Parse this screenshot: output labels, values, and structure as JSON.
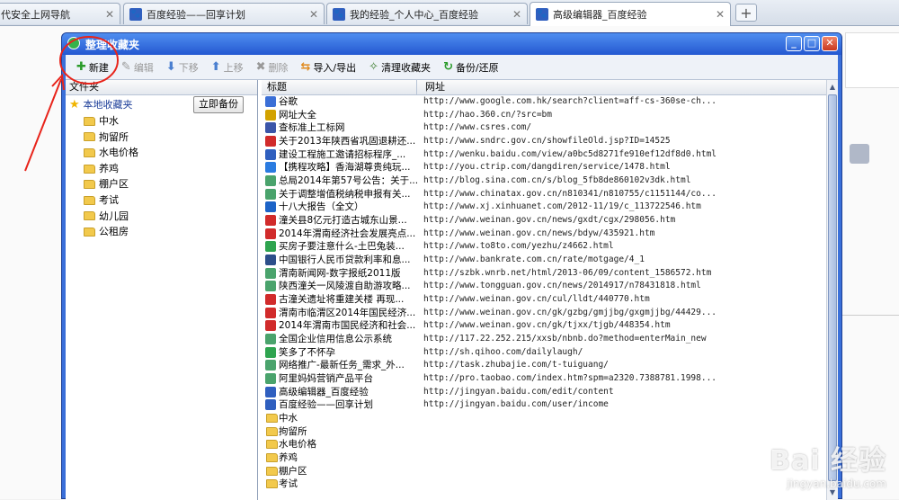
{
  "browser": {
    "tabs": [
      {
        "label": "代安全上网导航",
        "favicon": "360-icon",
        "active": false
      },
      {
        "label": "百度经验——回享计划",
        "favicon": "baidu-paw-icon",
        "active": false
      },
      {
        "label": "我的经验_个人中心_百度经验",
        "favicon": "baidu-paw-icon",
        "active": false
      },
      {
        "label": "高级编辑器_百度经验",
        "favicon": "baidu-paw-icon",
        "active": true
      }
    ],
    "new_tab_glyph": "+"
  },
  "dialog": {
    "title": "整理收藏夹",
    "toolbar": [
      {
        "label": "新建",
        "icon": "plus-icon",
        "color": "#2a9b2a",
        "enabled": true
      },
      {
        "label": "编辑",
        "icon": "pencil-icon",
        "color": "#999999",
        "enabled": false
      },
      {
        "label": "下移",
        "icon": "arrow-down-icon",
        "color": "#4a7fd0",
        "enabled": false
      },
      {
        "label": "上移",
        "icon": "arrow-up-icon",
        "color": "#4a7fd0",
        "enabled": false
      },
      {
        "label": "删除",
        "icon": "delete-x-icon",
        "color": "#999999",
        "enabled": false
      },
      {
        "label": "导入/导出",
        "icon": "import-export-icon",
        "color": "#e08a1e",
        "enabled": true
      },
      {
        "label": "清理收藏夹",
        "icon": "broom-icon",
        "color": "#3b7d2e",
        "enabled": true
      },
      {
        "label": "备份/还原",
        "icon": "refresh-icon",
        "color": "#2a9b2a",
        "enabled": true
      }
    ],
    "left": {
      "header": "文件夹",
      "root": "本地收藏夹",
      "backup_button": "立即备份",
      "folders": [
        "中水",
        "拘留所",
        "水电价格",
        "养鸡",
        "棚户区",
        "考试",
        "幼儿园",
        "公租房"
      ]
    },
    "right": {
      "col_title": "标题",
      "col_url": "网址",
      "rows": [
        {
          "title": "谷歌",
          "url": "http://www.google.com.hk/search?client=aff-cs-360se-ch...",
          "icon": "google-icon",
          "color": "#3b6fd6"
        },
        {
          "title": "网址大全",
          "url": "http://hao.360.cn/?src=bm",
          "icon": "360-icon",
          "color": "#d2a200"
        },
        {
          "title": "查标准上工标网",
          "url": "http://www.csres.com/",
          "icon": "shield-icon",
          "color": "#3b55a8"
        },
        {
          "title": "关于2013年陕西省巩固退耕还...",
          "url": "http://www.sndrc.gov.cn/showfileOld.jsp?ID=14525",
          "icon": "emblem-icon",
          "color": "#d12b2b"
        },
        {
          "title": "建设工程施工邀请招标程序_...",
          "url": "http://wenku.baidu.com/view/a0bc5d8271fe910ef12df8d0.html",
          "icon": "baidu-paw-icon",
          "color": "#2f5fbf"
        },
        {
          "title": "【携程攻略】香海湖尊贵纯玩...",
          "url": "http://you.ctrip.com/dangdiren/service/1478.html",
          "icon": "ctrip-icon",
          "color": "#2a7be0"
        },
        {
          "title": "总局2014年第57号公告：关于...",
          "url": "http://blog.sina.com.cn/s/blog_5fb8de860102v3dk.html",
          "icon": "page-icon",
          "color": "#4aa36c"
        },
        {
          "title": "关于调整增值税纳税申报有关...",
          "url": "http://www.chinatax.gov.cn/n810341/n810755/c1151144/co...",
          "icon": "page-icon",
          "color": "#4aa36c"
        },
        {
          "title": "十八大报告（全文）",
          "url": "http://www.xj.xinhuanet.com/2012-11/19/c_113722546.htm",
          "icon": "xinhua-icon",
          "color": "#1c63c7"
        },
        {
          "title": "潼关县8亿元打造古城东山景...",
          "url": "http://www.weinan.gov.cn/news/gxdt/cgx/298056.htm",
          "icon": "emblem-icon",
          "color": "#d12b2b"
        },
        {
          "title": "2014年渭南经济社会发展亮点...",
          "url": "http://www.weinan.gov.cn/news/bdyw/435921.htm",
          "icon": "emblem-icon",
          "color": "#d12b2b"
        },
        {
          "title": "买房子要注意什么-土巴兔装...",
          "url": "http://www.to8to.com/yezhu/z4662.html",
          "icon": "to8to-icon",
          "color": "#2ea44f"
        },
        {
          "title": "中国银行人民币贷款利率和息...",
          "url": "http://www.bankrate.com.cn/rate/motgage/4_1",
          "icon": "bankrate-icon",
          "color": "#2d4f8a"
        },
        {
          "title": "渭南新闻网-数字报纸2011版",
          "url": "http://szbk.wnrb.net/html/2013-06/09/content_1586572.htm",
          "icon": "page-icon",
          "color": "#4aa36c"
        },
        {
          "title": "陕西潼关一风陵渡自助游攻略...",
          "url": "http://www.tongguan.gov.cn/news/2014917/n78431818.html",
          "icon": "page-icon",
          "color": "#4aa36c"
        },
        {
          "title": "古潼关遗址将重建关楼 再现...",
          "url": "http://www.weinan.gov.cn/cul/lldt/440770.htm",
          "icon": "emblem-icon",
          "color": "#d12b2b"
        },
        {
          "title": "渭南市临渭区2014年国民经济...",
          "url": "http://www.weinan.gov.cn/gk/gzbg/gmjjbg/gxgmjjbg/44429...",
          "icon": "emblem-icon",
          "color": "#d12b2b"
        },
        {
          "title": "2014年渭南市国民经济和社会...",
          "url": "http://www.weinan.gov.cn/gk/tjxx/tjgb/448354.htm",
          "icon": "emblem-icon",
          "color": "#d12b2b"
        },
        {
          "title": "全国企业信用信息公示系统",
          "url": "http://117.22.252.215/xxsb/nbnb.do?method=enterMain_new",
          "icon": "page-icon",
          "color": "#4aa36c"
        },
        {
          "title": "笑多了不怀孕",
          "url": "http://sh.qihoo.com/dailylaugh/",
          "icon": "qihoo-search-icon",
          "color": "#2ea44f"
        },
        {
          "title": "网络推广-最新任务_需求_外...",
          "url": "http://task.zhubajie.com/t-tuiguang/",
          "icon": "page-icon",
          "color": "#4aa36c"
        },
        {
          "title": "阿里妈妈营销产品平台",
          "url": "http://pro.taobao.com/index.htm?spm=a2320.7388781.1998...",
          "icon": "page-icon",
          "color": "#4aa36c"
        },
        {
          "title": "高级编辑器_百度经验",
          "url": "http://jingyan.baidu.com/edit/content",
          "icon": "baidu-paw-icon",
          "color": "#2f5fbf"
        },
        {
          "title": "百度经验——回享计划",
          "url": "http://jingyan.baidu.com/user/income",
          "icon": "baidu-paw-icon",
          "color": "#2f5fbf"
        }
      ],
      "folder_rows": [
        "中水",
        "拘留所",
        "水电价格",
        "养鸡",
        "棚户区",
        "考试"
      ]
    }
  },
  "watermark": {
    "brand": "Bai 经验",
    "domain": "jingyan.baidu.com"
  },
  "annotation_color": "#e8231a"
}
